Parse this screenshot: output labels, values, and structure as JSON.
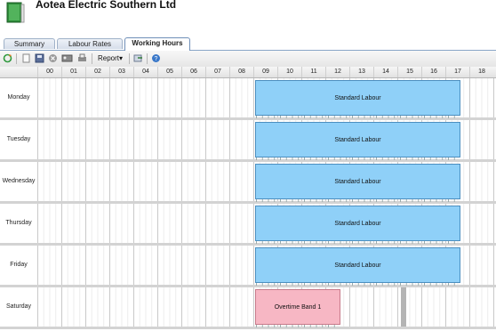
{
  "header": {
    "title": "Aotea Electric Southern Ltd",
    "logo_icon": "book-icon"
  },
  "tabs": [
    {
      "label": "Summary",
      "active": false
    },
    {
      "label": "Labour Rates",
      "active": false
    },
    {
      "label": "Working Hours",
      "active": true
    }
  ],
  "toolbar": {
    "report_label": "Report",
    "icons": [
      "refresh-icon",
      "document-icon",
      "save-icon",
      "cancel-icon",
      "contact-card-icon",
      "print-icon",
      "export-icon",
      "help-icon"
    ]
  },
  "hours": [
    "00",
    "01",
    "02",
    "03",
    "04",
    "05",
    "06",
    "07",
    "08",
    "09",
    "10",
    "11",
    "12",
    "13",
    "14",
    "15",
    "16",
    "17",
    "18"
  ],
  "days": [
    {
      "name": "Monday",
      "block": {
        "label": "Standard Labour",
        "type": "standard",
        "start": 9,
        "end": 18
      }
    },
    {
      "name": "Tuesday",
      "block": {
        "label": "Standard Labour",
        "type": "standard",
        "start": 9,
        "end": 18
      }
    },
    {
      "name": "Wednesday",
      "block": {
        "label": "Standard Labour",
        "type": "standard",
        "start": 9,
        "end": 18
      }
    },
    {
      "name": "Thursday",
      "block": {
        "label": "Standard Labour",
        "type": "standard",
        "start": 9,
        "end": 18
      }
    },
    {
      "name": "Friday",
      "block": {
        "label": "Standard Labour",
        "type": "standard",
        "start": 9,
        "end": 18
      }
    },
    {
      "name": "Saturday",
      "block": {
        "label": "Overtime Band 1",
        "type": "overtime",
        "start": 9,
        "end": 13
      }
    }
  ],
  "colors": {
    "standard": "#8fd0f8",
    "overtime": "#f7b7c4",
    "tab_border": "#6f8fb8"
  }
}
